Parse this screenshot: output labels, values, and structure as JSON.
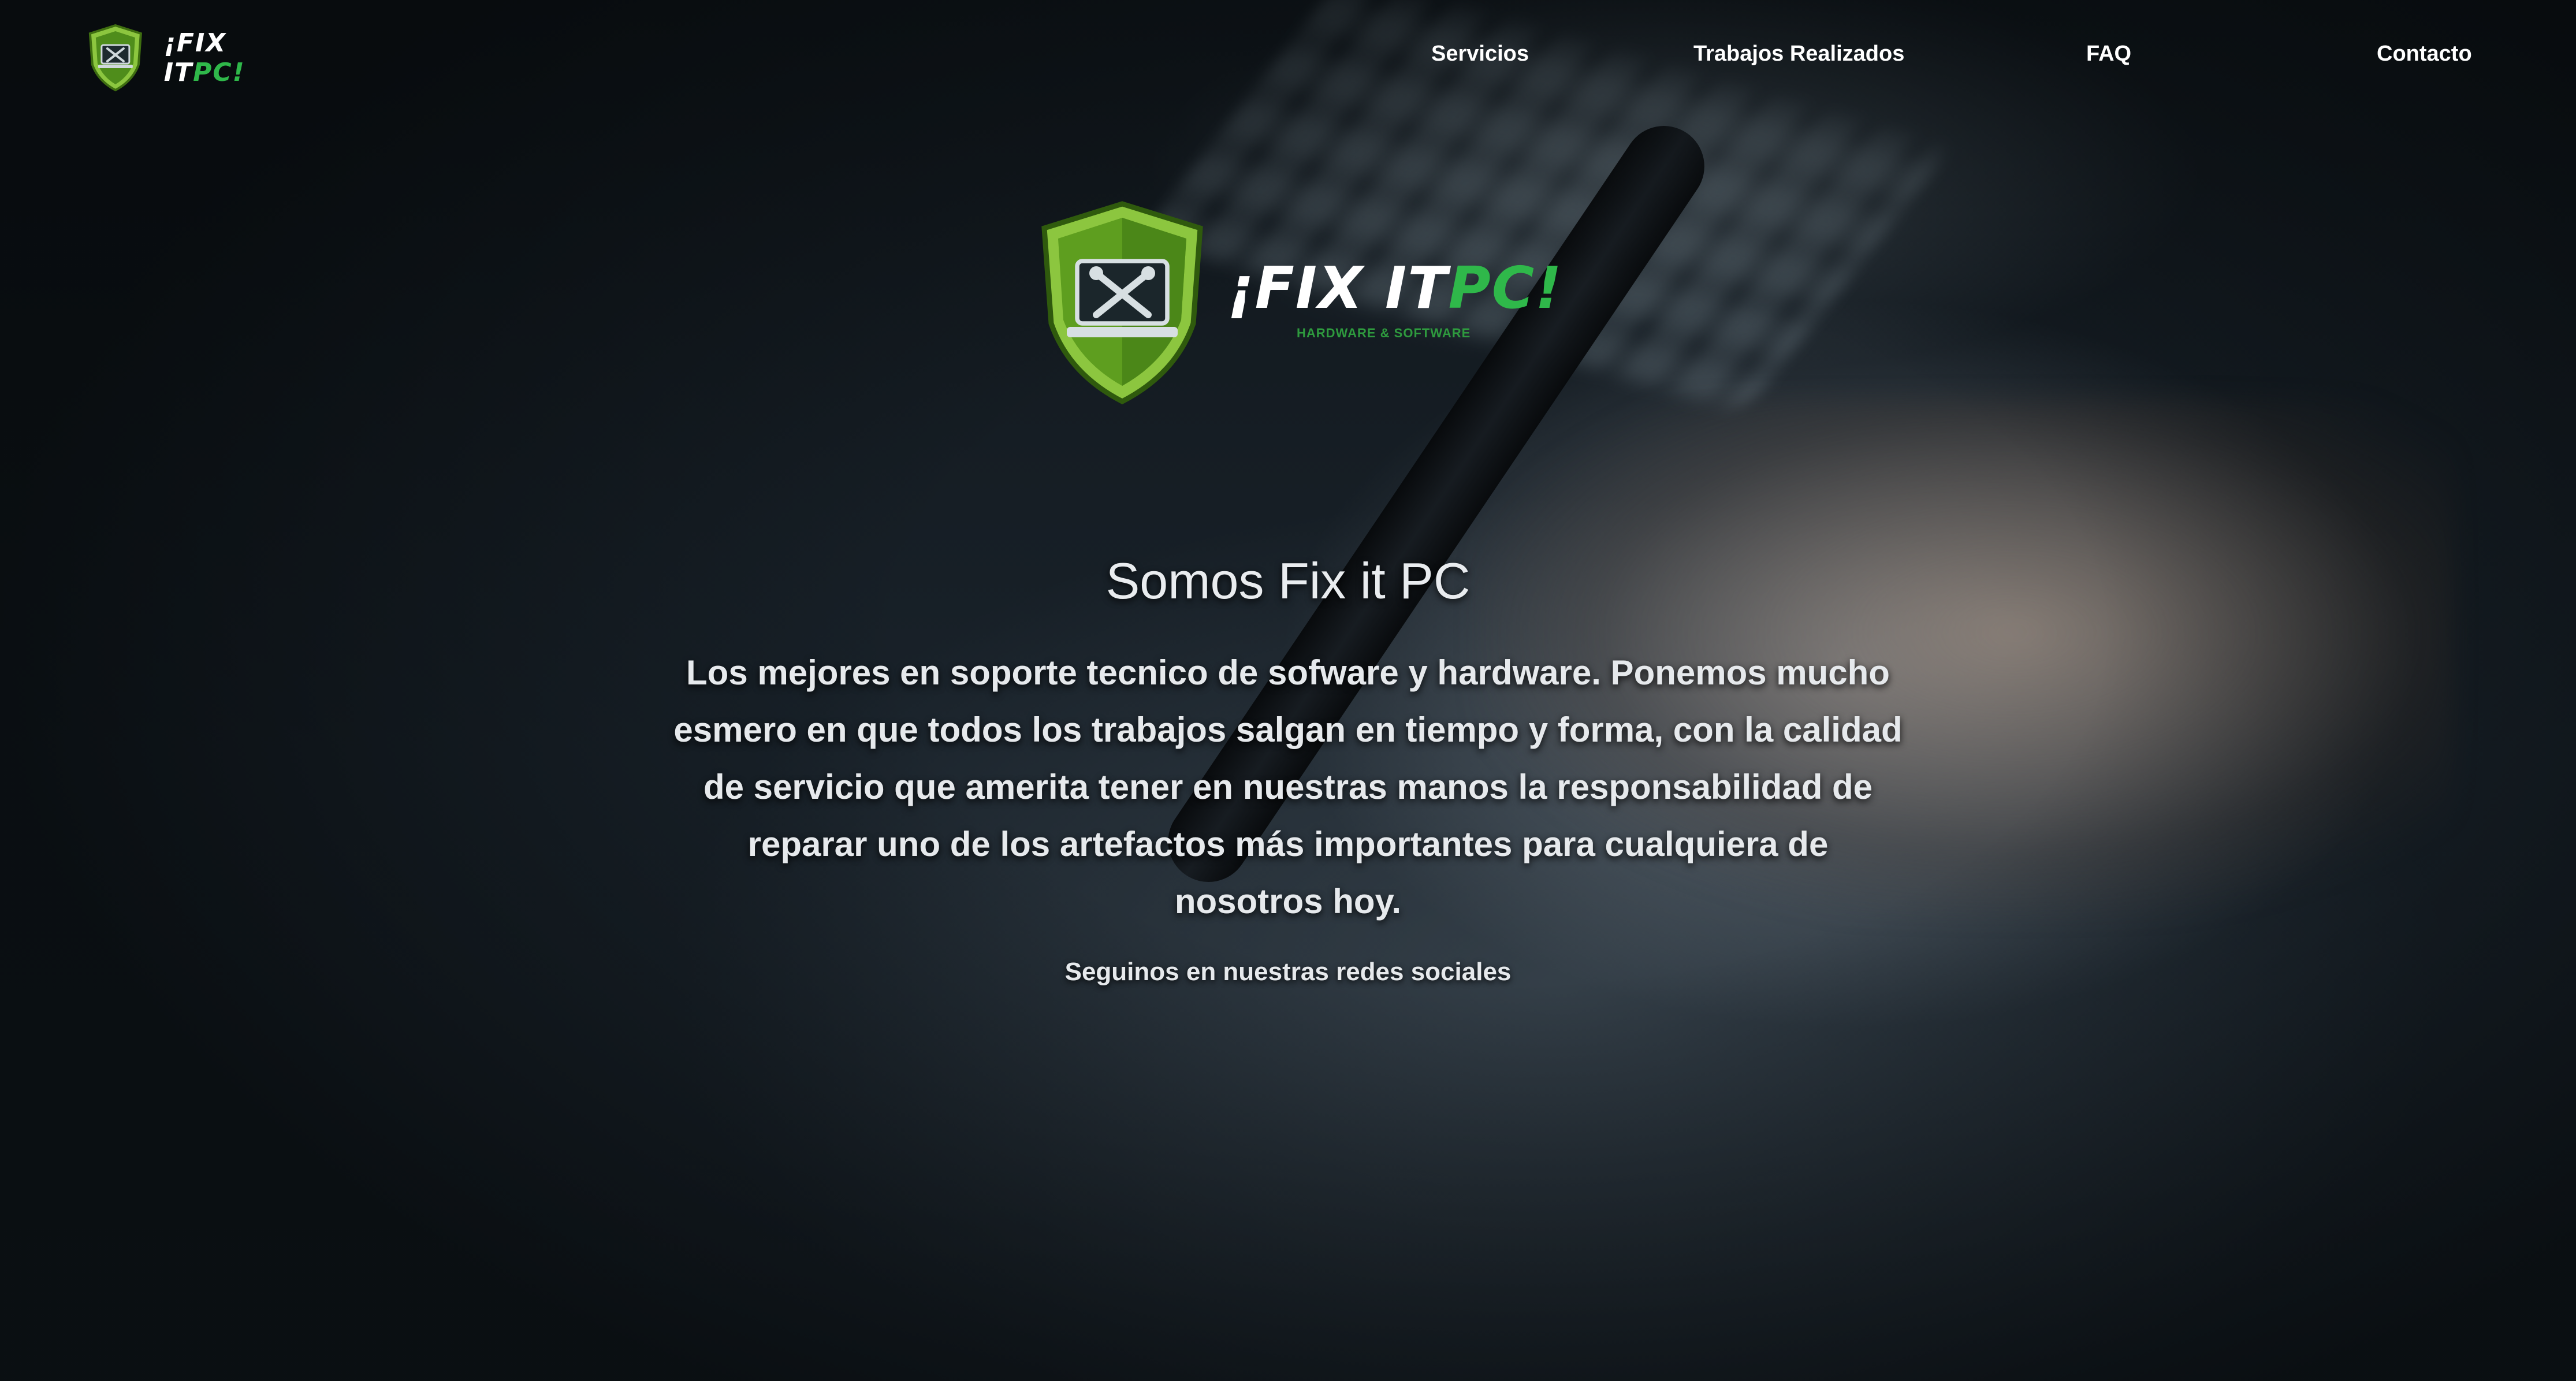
{
  "brand": {
    "logo_text_white": "¡FIX IT",
    "logo_text_green": "PC!",
    "tagline": "HARDWARE & SOFTWARE",
    "colors": {
      "green": "#2fb84a",
      "shield": "#7fc32a"
    }
  },
  "nav": {
    "links": [
      {
        "label": "Servicios"
      },
      {
        "label": "Trabajos Realizados"
      },
      {
        "label": "FAQ"
      },
      {
        "label": "Contacto"
      }
    ]
  },
  "hero": {
    "title": "Somos Fix it PC",
    "description": "Los mejores en soporte tecnico de sofware y hardware. Ponemos mucho esmero en que todos los trabajos salgan en tiempo y forma, con la calidad de servicio que amerita tener en nuestras manos la responsabilidad de reparar uno de los artefactos más importantes para cualquiera de nosotros hoy.",
    "social_text": "Seguinos en nuestras redes sociales"
  }
}
